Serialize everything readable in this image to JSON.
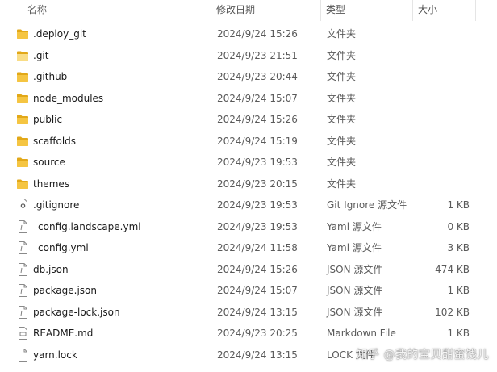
{
  "header": {
    "name": "名称",
    "date": "修改日期",
    "type": "类型",
    "size": "大小",
    "sort_indicator": "^"
  },
  "files": [
    {
      "name": ".deploy_git",
      "date": "2024/9/24 15:26",
      "type": "文件夹",
      "size": "",
      "icon": "folder-icon"
    },
    {
      "name": ".git",
      "date": "2024/9/23 21:51",
      "type": "文件夹",
      "size": "",
      "icon": "folder-light-icon"
    },
    {
      "name": ".github",
      "date": "2024/9/23 20:44",
      "type": "文件夹",
      "size": "",
      "icon": "folder-icon"
    },
    {
      "name": "node_modules",
      "date": "2024/9/24 15:07",
      "type": "文件夹",
      "size": "",
      "icon": "folder-icon"
    },
    {
      "name": "public",
      "date": "2024/9/24 15:26",
      "type": "文件夹",
      "size": "",
      "icon": "folder-icon"
    },
    {
      "name": "scaffolds",
      "date": "2024/9/24 15:19",
      "type": "文件夹",
      "size": "",
      "icon": "folder-icon"
    },
    {
      "name": "source",
      "date": "2024/9/23 19:53",
      "type": "文件夹",
      "size": "",
      "icon": "folder-icon"
    },
    {
      "name": "themes",
      "date": "2024/9/23 20:15",
      "type": "文件夹",
      "size": "",
      "icon": "folder-icon"
    },
    {
      "name": ".gitignore",
      "date": "2024/9/23 19:53",
      "type": "Git Ignore 源文件",
      "size": "1 KB",
      "icon": "gear-file-icon"
    },
    {
      "name": "_config.landscape.yml",
      "date": "2024/9/23 19:53",
      "type": "Yaml 源文件",
      "size": "0 KB",
      "icon": "text-file-icon"
    },
    {
      "name": "_config.yml",
      "date": "2024/9/24 11:58",
      "type": "Yaml 源文件",
      "size": "3 KB",
      "icon": "text-file-icon"
    },
    {
      "name": "db.json",
      "date": "2024/9/24 15:26",
      "type": "JSON 源文件",
      "size": "474 KB",
      "icon": "text-file-icon"
    },
    {
      "name": "package.json",
      "date": "2024/9/24 15:07",
      "type": "JSON 源文件",
      "size": "1 KB",
      "icon": "text-file-icon"
    },
    {
      "name": "package-lock.json",
      "date": "2024/9/24 13:15",
      "type": "JSON 源文件",
      "size": "102 KB",
      "icon": "text-file-icon"
    },
    {
      "name": "README.md",
      "date": "2024/9/23 20:25",
      "type": "Markdown File",
      "size": "1 KB",
      "icon": "markdown-file-icon"
    },
    {
      "name": "yarn.lock",
      "date": "2024/9/24 13:15",
      "type": "LOCK 文件",
      "size": "",
      "icon": "blank-file-icon"
    }
  ],
  "watermark": "知乎 @我的宝贝甜蜜饯儿",
  "colors": {
    "folder": "#f5c542",
    "folder_shadow": "#e2a818",
    "folder_light": "#f9dd86",
    "file_border": "#8a8a8a"
  }
}
